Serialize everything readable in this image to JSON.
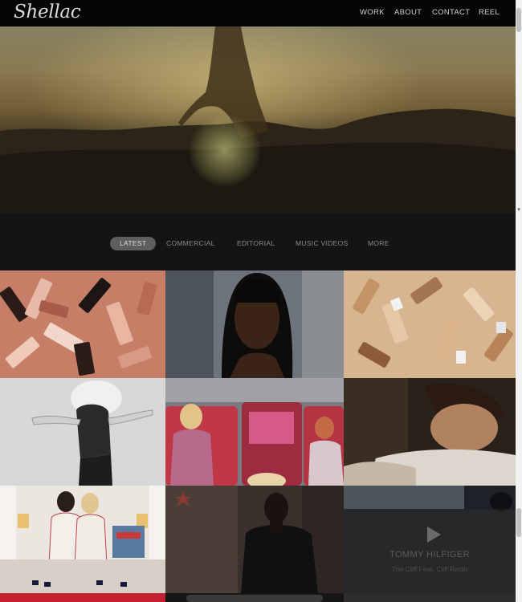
{
  "brand": {
    "logo": "Shellac"
  },
  "nav": {
    "items": [
      "WORK",
      "ABOUT",
      "CONTACT",
      "REEL"
    ]
  },
  "filters": {
    "items": [
      "LATEST",
      "COMMERCIAL",
      "EDITORIAL",
      "MUSIC VIDEOS",
      "MORE"
    ],
    "active": "LATEST"
  },
  "overlay": {
    "title": "TOMMY HILFIGER",
    "subtitle": "The Cliff Feat. Cliff Radio",
    "icon": "play-icon"
  },
  "grid": {
    "tiles": [
      "lipstick-tubes-pink",
      "model-portrait-outdoor",
      "foundation-bottles-nude",
      "dancer-black-and-white",
      "airplane-passengers",
      "man-resting-head",
      "two-women-bedroom",
      "man-leather-jacket",
      "tommy-hilfiger-video"
    ]
  },
  "colors": {
    "background": "#101010",
    "header": "#050505",
    "active_filter": "#5e5e5e"
  }
}
